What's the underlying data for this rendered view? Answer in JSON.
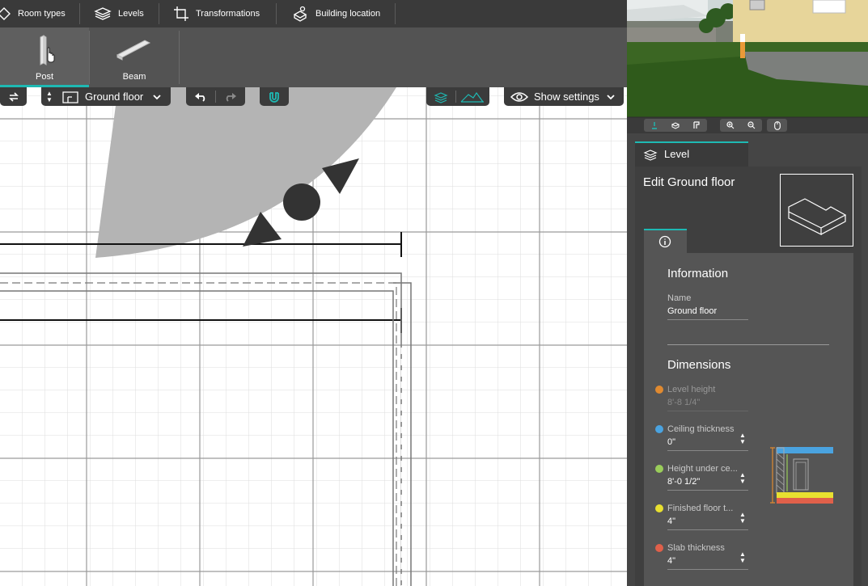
{
  "toolbar": {
    "room_types": "Room types",
    "levels": "Levels",
    "transformations": "Transformations",
    "building_location": "Building location"
  },
  "tools": {
    "post": "Post",
    "beam": "Beam"
  },
  "canvas_controls": {
    "level_select": "Ground floor",
    "show_settings": "Show settings"
  },
  "panel": {
    "tab_label": "Level",
    "edit_title": "Edit Ground floor",
    "information_heading": "Information",
    "name_label": "Name",
    "name_value": "Ground floor",
    "dimensions_heading": "Dimensions",
    "fields": [
      {
        "label": "Level height",
        "value": "8'-8 1/4\"",
        "color": "#e08a30",
        "disabled": true
      },
      {
        "label": "Ceiling thickness",
        "value": "0\"",
        "color": "#4aa3e0",
        "disabled": false
      },
      {
        "label": "Height under ce...",
        "value": "8'-0 1/2\"",
        "color": "#9acd5a",
        "disabled": false
      },
      {
        "label": "Finished floor t...",
        "value": "4\"",
        "color": "#e8e030",
        "disabled": false
      },
      {
        "label": "Slab thickness",
        "value": "4\"",
        "color": "#e0604a",
        "disabled": false
      }
    ]
  },
  "colors": {
    "accent": "#1eb9b3"
  }
}
